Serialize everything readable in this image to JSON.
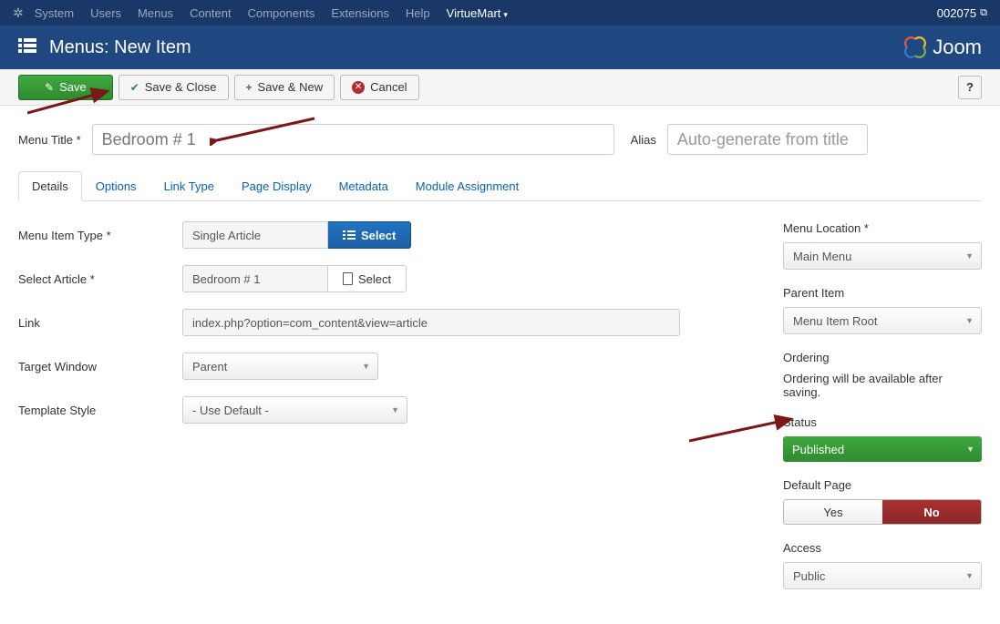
{
  "topnav": {
    "items": [
      "System",
      "Users",
      "Menus",
      "Content",
      "Components",
      "Extensions",
      "Help"
    ],
    "active": "VirtueMart",
    "ext_id": "002075"
  },
  "header": {
    "title": "Menus: New Item",
    "brand": "Joom"
  },
  "toolbar": {
    "save": "Save",
    "save_close": "Save & Close",
    "save_new": "Save & New",
    "cancel": "Cancel"
  },
  "title_row": {
    "menu_title_label": "Menu Title *",
    "menu_title_value": "Bedroom # 1",
    "alias_label": "Alias",
    "alias_placeholder": "Auto-generate from title"
  },
  "tabs": [
    "Details",
    "Options",
    "Link Type",
    "Page Display",
    "Metadata",
    "Module Assignment"
  ],
  "details": {
    "menu_item_type_label": "Menu Item Type *",
    "menu_item_type_value": "Single Article",
    "menu_item_type_action": "Select",
    "select_article_label": "Select Article *",
    "select_article_value": "Bedroom # 1",
    "select_article_action": "Select",
    "link_label": "Link",
    "link_value": "index.php?option=com_content&view=article",
    "target_window_label": "Target Window",
    "target_window_value": "Parent",
    "template_style_label": "Template Style",
    "template_style_value": "- Use Default -"
  },
  "sidebar": {
    "menu_location_label": "Menu Location *",
    "menu_location_value": "Main Menu",
    "parent_item_label": "Parent Item",
    "parent_item_value": "Menu Item Root",
    "ordering_label": "Ordering",
    "ordering_note": "Ordering will be available after saving.",
    "status_label": "Status",
    "status_value": "Published",
    "default_page_label": "Default Page",
    "default_page_yes": "Yes",
    "default_page_no": "No",
    "access_label": "Access",
    "access_value": "Public"
  }
}
